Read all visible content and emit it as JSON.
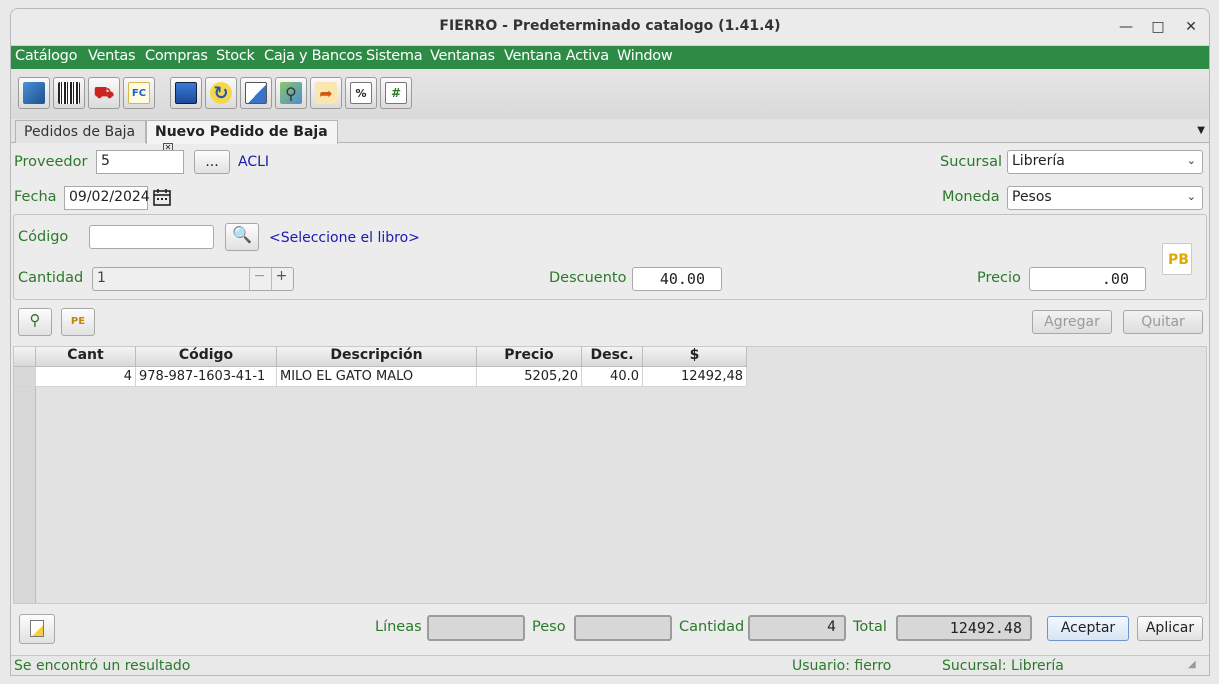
{
  "window": {
    "title": "FIERRO - Predeterminado catalogo (1.41.4)"
  },
  "menu": [
    "Catálogo",
    "Ventas",
    "Compras",
    "Stock",
    "Caja y Bancos",
    "Sistema",
    "Ventanas",
    "Ventana Activa",
    "Window"
  ],
  "tabs": [
    "Pedidos de Baja",
    "Nuevo Pedido de Baja"
  ],
  "form": {
    "proveedor_label": "Proveedor",
    "proveedor_value": "5",
    "browse_label": "...",
    "proveedor_name": "ACLI",
    "sucursal_label": "Sucursal",
    "sucursal_value": "Librería",
    "fecha_label": "Fecha",
    "fecha_value": "09/02/2024",
    "moneda_label": "Moneda",
    "moneda_value": "Pesos",
    "codigo_label": "Código",
    "codigo_value": "",
    "seleccione_link": "<Seleccione el libro>",
    "cantidad_label": "Cantidad",
    "cantidad_value": "1",
    "descuento_label": "Descuento",
    "descuento_value": "40.00",
    "precio_label": "Precio",
    "precio_value": ".00",
    "pb_badge": "PB",
    "agregar_label": "Agregar",
    "quitar_label": "Quitar"
  },
  "table": {
    "columns": [
      "Cant",
      "Código",
      "Descripción",
      "Precio",
      "Desc.",
      "$"
    ],
    "rows": [
      {
        "cant": "4",
        "codigo": "978-987-1603-41-1",
        "descripcion": "MILO EL GATO MALO",
        "precio": "5205,20",
        "desc": "40.0",
        "total": "12492,48"
      }
    ]
  },
  "footer": {
    "lineas_label": "Líneas",
    "lineas_value": "",
    "peso_label": "Peso",
    "peso_value": "",
    "cantidad_label": "Cantidad",
    "cantidad_value": "4",
    "total_label": "Total",
    "total_value": "12492.48",
    "aceptar_label": "Aceptar",
    "aplicar_label": "Aplicar"
  },
  "status": {
    "message": "Se encontró un resultado",
    "usuario": "Usuario: fierro",
    "sucursal": "Sucursal: Librería"
  },
  "colors": {
    "menubar": "#2e8b46",
    "label_green": "#2a7a2a",
    "link_blue": "#1a1ab0"
  },
  "icons": [
    "book-icon",
    "barcode-icon",
    "truck-icon",
    "fc-icon",
    "save-icon",
    "refresh-icon",
    "document-icon",
    "search-map-icon",
    "export-icon",
    "percent-icon",
    "hash-icon"
  ]
}
